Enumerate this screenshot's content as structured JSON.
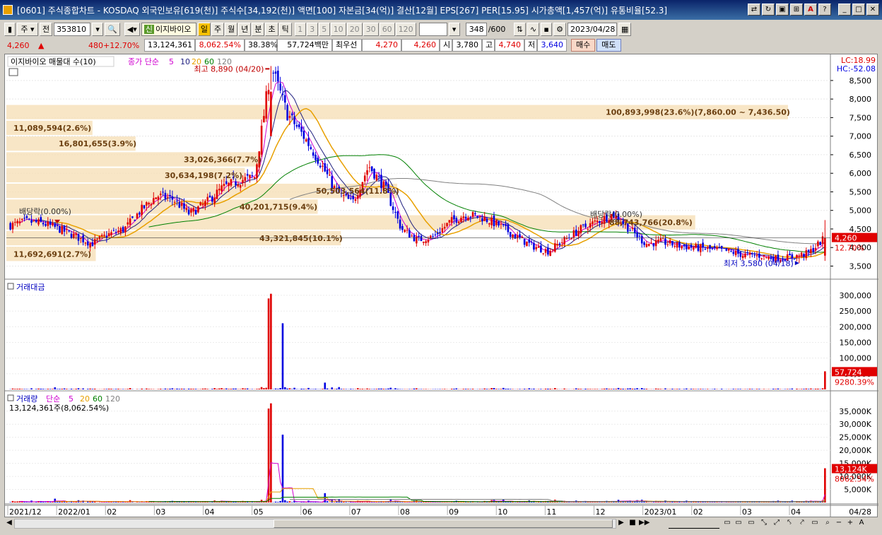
{
  "window": {
    "title": "[0601] 주식종합차트 - KOSDAQ 외국인보유[619(천)] 주식수[34,192(천)] 액면[100] 자본금[34(억)] 결산[12월] EPS[267] PER[15.95] 시가총액[1,457(억)] 유통비율[52.3]",
    "btn_max": "□",
    "btn_min": "_",
    "btn_close": "✕",
    "btn_help": "?",
    "btn_a": "A"
  },
  "toolbar": {
    "code_type": "주",
    "prev": "전",
    "code": "353810",
    "name": "이지바이오",
    "name_prefix": "신",
    "period_buttons": [
      "일",
      "주",
      "월",
      "년",
      "분",
      "초",
      "틱"
    ],
    "active_period": "일",
    "interval_buttons": [
      "1",
      "3",
      "5",
      "10",
      "20",
      "30",
      "60",
      "120"
    ],
    "count": "348",
    "count_total": "/600",
    "date": "2023/04/28"
  },
  "quote": {
    "price": "4,260",
    "arrow": "▲",
    "change": "480",
    "change_pct": "+12.70%",
    "volume": "13,124,361",
    "volume_ratio": "8,062.54%",
    "turnover_pct": "38.38%",
    "amount": "57,724백만",
    "best_label": "최우선",
    "best_ask": "4,270",
    "best_bid": "4,260",
    "open_label": "시",
    "open": "3,780",
    "high_label": "고",
    "high": "4,740",
    "low_label": "저",
    "low": "3,640",
    "buy": "매수",
    "sell": "매도"
  },
  "price_panel": {
    "legend_name": "이지바이오 매물대 수(10)",
    "ma_label": "종가 단순",
    "ma_periods": [
      "5",
      "10",
      "20",
      "60",
      "120"
    ],
    "lc": "LC:18.99",
    "hc": "HC:-52.08",
    "high_note": "최고 8,890 (04/20)",
    "low_note": "최저 3,580 (04/18)",
    "dividend_1": "배당락(0.00%)",
    "dividend_2": "배당락(0.00%)",
    "cur_price_tag": "4,260",
    "cur_pct_tag": "12.70%",
    "y_ticks": [
      "8,500",
      "8,000",
      "7,500",
      "7,000",
      "6,500",
      "6,000",
      "5,500",
      "5,000",
      "4,500",
      "4,000",
      "3,500"
    ],
    "y_min": 3300,
    "y_max": 9050
  },
  "volume_profile": [
    {
      "label": "100,893,998(23.6%)(7,860.00 ~ 7,436.50)",
      "low": 7436,
      "high": 7860,
      "pct": 23.6
    },
    {
      "label": "11,089,594(2.6%)",
      "low": 7012,
      "high": 7436,
      "pct": 2.6
    },
    {
      "label": "16,801,655(3.9%)",
      "low": 6587,
      "high": 7012,
      "pct": 3.9
    },
    {
      "label": "33,026,366(7.7%)",
      "low": 6163,
      "high": 6587,
      "pct": 7.7
    },
    {
      "label": "30,634,198(7.2%)",
      "low": 5738,
      "high": 6163,
      "pct": 7.2
    },
    {
      "label": "50,503,564(11.8%)",
      "low": 5314,
      "high": 5738,
      "pct": 11.8
    },
    {
      "label": "40,201,715(9.4%)",
      "low": 4889,
      "high": 5314,
      "pct": 9.4
    },
    {
      "label": "88,743,766(20.8%)",
      "low": 4465,
      "high": 4889,
      "pct": 20.8
    },
    {
      "label": "43,321,845(10.1%)",
      "low": 4040,
      "high": 4465,
      "pct": 10.1
    },
    {
      "label": "11,692,691(2.7%)",
      "low": 3616,
      "high": 4040,
      "pct": 2.7
    }
  ],
  "amount_panel": {
    "title": "거래대금",
    "y_ticks": [
      "300,000",
      "250,000",
      "200,000",
      "150,000",
      "100,000",
      "50,000"
    ],
    "tag_value": "57,724",
    "tag_pct": "9280.39%",
    "y_max": 320000
  },
  "volume_panel": {
    "title": "거래량",
    "ma_label": "단순",
    "ma_periods": [
      "5",
      "20",
      "60",
      "120"
    ],
    "info": "13,124,361주(8,062.54%)",
    "y_ticks": [
      "35,000K",
      "30,000K",
      "25,000K",
      "20,000K",
      "15,000K",
      "10,000K",
      "5,000K"
    ],
    "tag_value": "13,124K",
    "tag_pct": "8062.54%",
    "y_max": 39000
  },
  "x_axis": {
    "labels": [
      "2021/12",
      "2022/01",
      "02",
      "03",
      "04",
      "05",
      "06",
      "07",
      "08",
      "09",
      "10",
      "11",
      "12",
      "2023/01",
      "02",
      "03",
      "04"
    ],
    "right_label": "04/28"
  },
  "colors": {
    "up": "#e00000",
    "down": "#0000e0",
    "ma5": "#d000d0",
    "ma10": "#202080",
    "ma20": "#e8a000",
    "ma60": "#008000",
    "ma120": "#808080",
    "profile": "#f5deb3"
  },
  "chart_data": {
    "type": "candlestick",
    "series_anchor_closes": [
      4600,
      4700,
      4650,
      4500,
      4300,
      4100,
      4350,
      4500,
      5000,
      5400,
      5300,
      4900,
      5200,
      5600,
      5800,
      5900,
      8890,
      7600,
      7000,
      6300,
      5500,
      5200,
      6200,
      5600,
      4500,
      4200,
      4300,
      4700,
      4900,
      4800,
      4600,
      4300,
      4050,
      3900,
      4200,
      4500,
      4700,
      4900,
      4500,
      4100,
      4150,
      4050,
      4000,
      3950,
      3900,
      3800,
      3780,
      3700,
      3750,
      3850,
      4260
    ],
    "range": {
      "min_low": 3580,
      "max_high": 8890
    },
    "last": {
      "open": 3780,
      "high": 4740,
      "low": 3640,
      "close": 4260,
      "volume": 13124361,
      "amount_million": 57724
    }
  }
}
